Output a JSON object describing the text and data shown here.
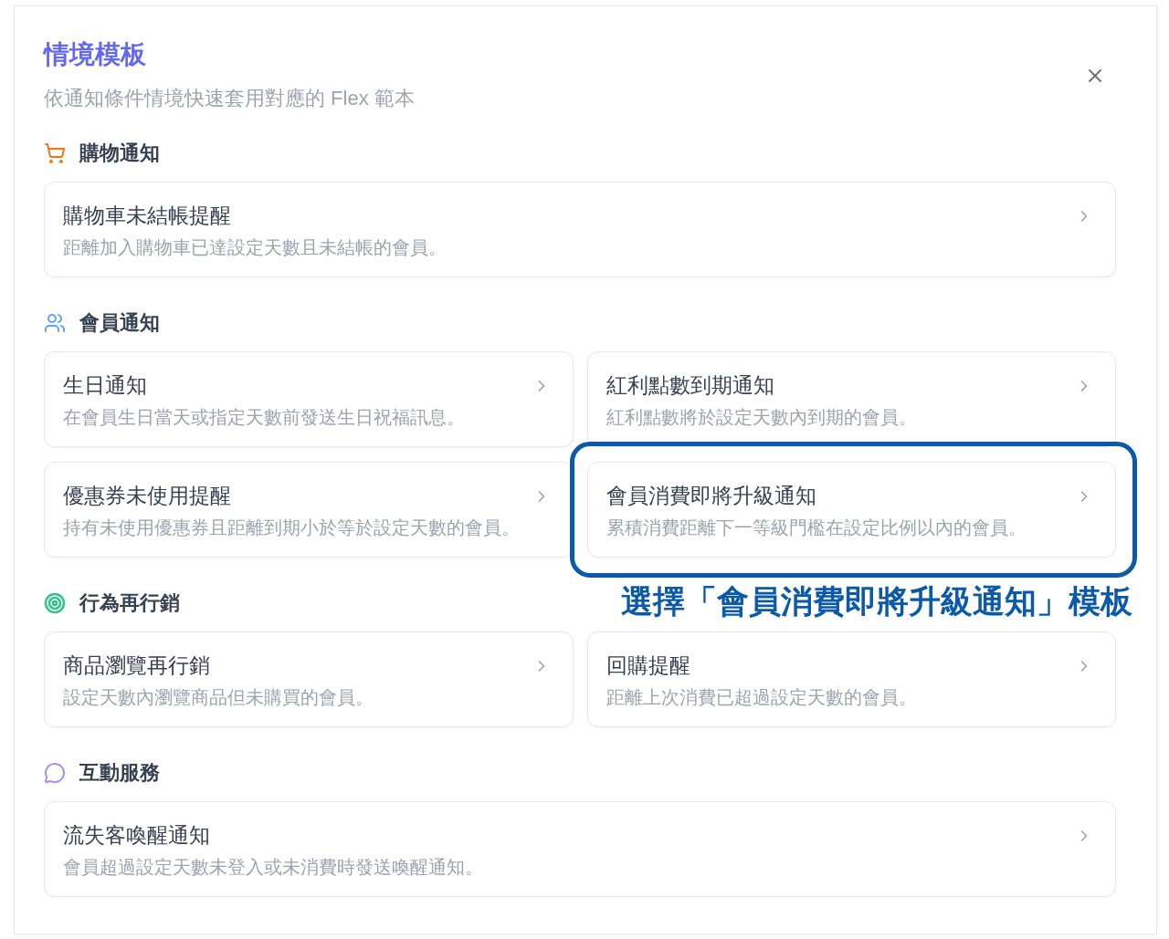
{
  "dialog": {
    "title": "情境模板",
    "subtitle": "依通知條件情境快速套用對應的 Flex 範本"
  },
  "sections": [
    {
      "title": "購物通知",
      "kind": "cart",
      "color": "#f97316",
      "cards": [
        {
          "title": "購物車未結帳提醒",
          "description": "距離加入購物車已達設定天數且未結帳的會員。",
          "highlighted": false
        }
      ]
    },
    {
      "title": "會員通知",
      "kind": "users",
      "color": "#60a5fa",
      "cards": [
        {
          "title": "生日通知",
          "description": "在會員生日當天或指定天數前發送生日祝福訊息。",
          "highlighted": false
        },
        {
          "title": "紅利點數到期通知",
          "description": "紅利點數將於設定天數內到期的會員。",
          "highlighted": false
        },
        {
          "title": "優惠券未使用提醒",
          "description": "持有未使用優惠券且距離到期小於等於設定天數的會員。",
          "highlighted": false
        },
        {
          "title": "會員消費即將升級通知",
          "description": "累積消費距離下一等級門檻在設定比例以內的會員。",
          "highlighted": true
        }
      ]
    },
    {
      "title": "行為再行銷",
      "kind": "target",
      "color": "#34c38f",
      "cards": [
        {
          "title": "商品瀏覽再行銷",
          "description": "設定天數內瀏覽商品但未購買的會員。",
          "highlighted": false
        },
        {
          "title": "回購提醒",
          "description": "距離上次消費已超過設定天數的會員。",
          "highlighted": false
        }
      ]
    },
    {
      "title": "互動服務",
      "kind": "chat",
      "color": "#a78bfa",
      "cards": [
        {
          "title": "流失客喚醒通知",
          "description": "會員超過設定天數未登入或未消費時發送喚醒通知。",
          "highlighted": false
        }
      ]
    }
  ],
  "annotation": {
    "text": "選擇「會員消費即將升級通知」模板"
  }
}
